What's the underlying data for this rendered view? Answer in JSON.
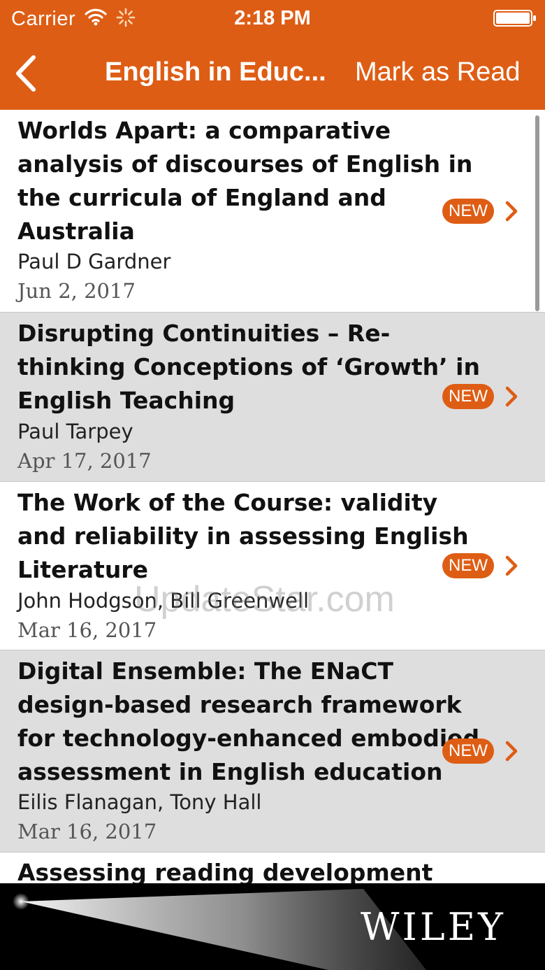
{
  "status_bar": {
    "carrier": "Carrier",
    "time": "2:18 PM",
    "wifi_icon": "wifi-icon",
    "activity_icon": "activity-spinner-icon",
    "battery_icon": "battery-icon"
  },
  "nav_bar": {
    "back_icon": "chevron-left-icon",
    "title": "English in Educ...",
    "mark_read_label": "Mark as Read"
  },
  "articles": [
    {
      "title_lines": [
        "Worlds Apart: a comparative",
        "analysis of discourses of English in",
        "the curricula of England and",
        "Australia"
      ],
      "authors": "Paul D Gardner",
      "date": "Jun 2, 2017",
      "badge": "NEW"
    },
    {
      "title_lines": [
        "Disrupting Continuities – Re-",
        "thinking Conceptions of ‘Growth’ in",
        "English Teaching"
      ],
      "authors": "Paul Tarpey",
      "date": "Apr 17, 2017",
      "badge": "NEW"
    },
    {
      "title_lines": [
        "The Work of the Course: validity",
        "and reliability in assessing English",
        "Literature"
      ],
      "authors": "John Hodgson, Bill Greenwell",
      "date": "Mar 16, 2017",
      "badge": "NEW"
    },
    {
      "title_lines": [
        "Digital Ensemble: The ENaCT",
        "design-based research framework",
        "for technology-enhanced embodied",
        "assessment in English education"
      ],
      "authors": "Eilis Flanagan, Tony Hall",
      "date": "Mar 16, 2017",
      "badge": "NEW"
    }
  ],
  "partial_article_title": "Assessing reading development",
  "watermark": "UpdateStar.com",
  "footer": {
    "logo_text": "WILEY"
  },
  "colors": {
    "accent": "#de5d14",
    "row_shade": "#dedede"
  }
}
